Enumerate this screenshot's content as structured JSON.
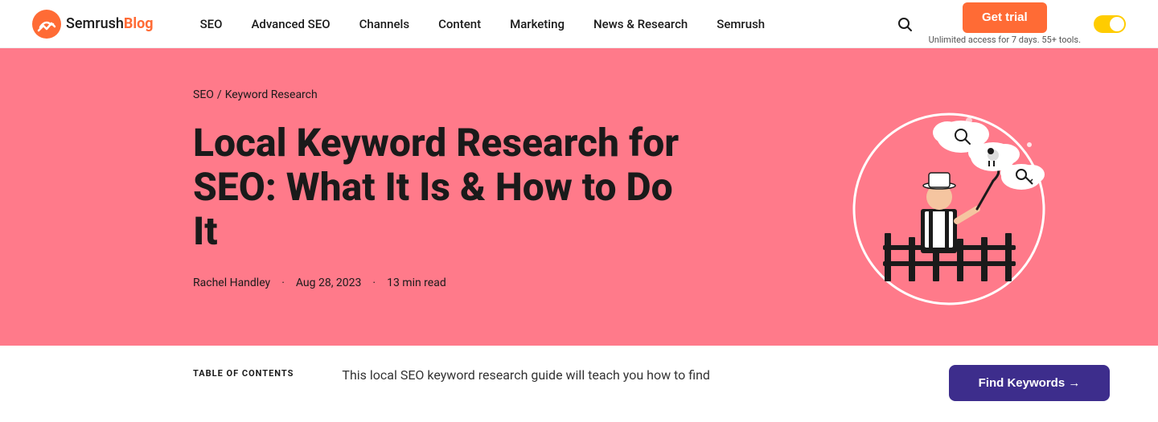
{
  "nav": {
    "logo_semrush": "Semrush",
    "logo_blog": "Blog",
    "links": [
      {
        "label": "SEO",
        "href": "#"
      },
      {
        "label": "Advanced SEO",
        "href": "#"
      },
      {
        "label": "Channels",
        "href": "#"
      },
      {
        "label": "Content",
        "href": "#"
      },
      {
        "label": "Marketing",
        "href": "#"
      },
      {
        "label": "News & Research",
        "href": "#"
      },
      {
        "label": "Semrush",
        "href": "#"
      }
    ],
    "get_trial_label": "Get trial",
    "trial_sub": "Unlimited access for 7 days. 55+ tools.",
    "toggle_aria": "Toggle"
  },
  "hero": {
    "breadcrumb_seo": "SEO",
    "breadcrumb_sep": "/",
    "breadcrumb_page": "Keyword Research",
    "title": "Local Keyword Research for SEO: What It Is & How to Do It",
    "author": "Rachel Handley",
    "date": "Aug 28, 2023",
    "read_time": "13 min read"
  },
  "bottom": {
    "toc_label": "TABLE OF CONTENTS",
    "intro_text": "This local SEO keyword research guide will teach you how to find",
    "cta_label": "Find Keywords →"
  },
  "colors": {
    "hero_bg": "#ff7a8a",
    "accent_orange": "#ff6b35",
    "accent_yellow": "#ffcc00",
    "cta_purple": "#3d2d8c"
  }
}
